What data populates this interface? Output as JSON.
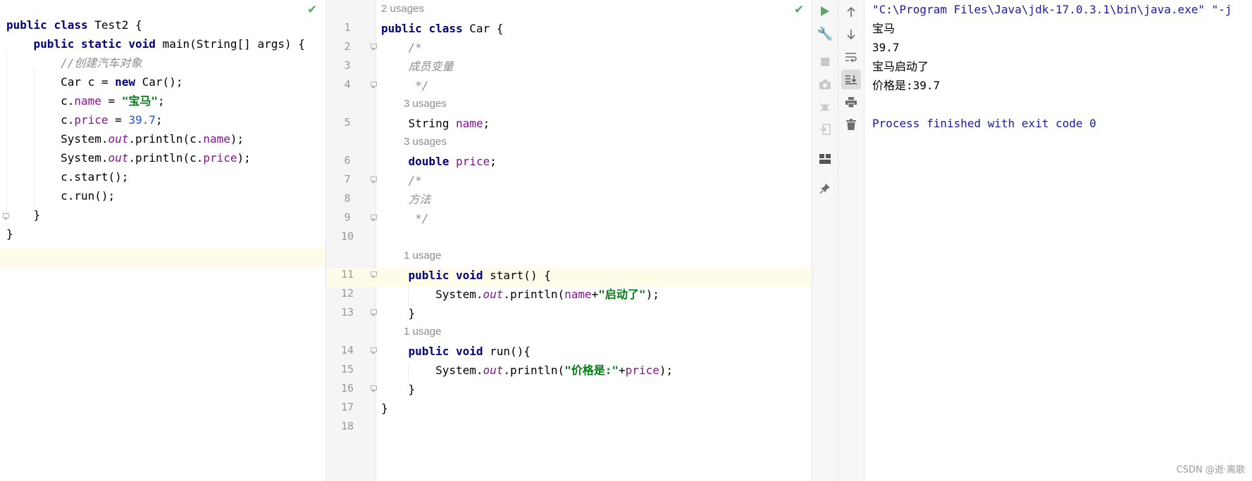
{
  "left_editor": {
    "lines": [
      {
        "parts": [
          [
            "kw2",
            "public "
          ],
          [
            "kw2",
            "class "
          ],
          [
            "",
            "Test2 {"
          ]
        ]
      },
      {
        "parts": [
          [
            "",
            "    "
          ],
          [
            "kw2",
            "public "
          ],
          [
            "kw2",
            "static "
          ],
          [
            "kw2",
            "void "
          ],
          [
            "",
            "main(String[] args) {"
          ]
        ]
      },
      {
        "parts": [
          [
            "",
            "        "
          ],
          [
            "cmt",
            "//创建汽车对象"
          ]
        ]
      },
      {
        "parts": [
          [
            "",
            "        Car c = "
          ],
          [
            "kw2",
            "new "
          ],
          [
            "",
            "Car();"
          ]
        ]
      },
      {
        "parts": [
          [
            "",
            "        c."
          ],
          [
            "fld",
            "name"
          ],
          [
            "",
            " = "
          ],
          [
            "str",
            "\"宝马\""
          ],
          [
            "",
            ";"
          ]
        ]
      },
      {
        "parts": [
          [
            "",
            "        c."
          ],
          [
            "fld",
            "price"
          ],
          [
            "",
            " = "
          ],
          [
            "num",
            "39.7"
          ],
          [
            "",
            ";"
          ]
        ]
      },
      {
        "parts": [
          [
            "",
            "        System."
          ],
          [
            "sta",
            "out"
          ],
          [
            "",
            ".println(c."
          ],
          [
            "fld",
            "name"
          ],
          [
            "",
            ");"
          ]
        ]
      },
      {
        "parts": [
          [
            "",
            "        System."
          ],
          [
            "sta",
            "out"
          ],
          [
            "",
            ".println(c."
          ],
          [
            "fld",
            "price"
          ],
          [
            "",
            ");"
          ]
        ]
      },
      {
        "parts": [
          [
            "",
            "        c.start();"
          ]
        ]
      },
      {
        "parts": [
          [
            "",
            "        c.run();"
          ]
        ]
      },
      {
        "parts": [
          [
            "",
            "    }"
          ]
        ]
      },
      {
        "parts": [
          [
            "",
            "}"
          ]
        ]
      }
    ]
  },
  "right_editor": {
    "top_hint": "2 usages",
    "rows": [
      {
        "num": "1",
        "hint": "",
        "parts": [
          [
            "kw2",
            "public "
          ],
          [
            "kw2",
            "class "
          ],
          [
            "",
            "Car {"
          ]
        ]
      },
      {
        "num": "2",
        "hint": "",
        "parts": [
          [
            "",
            "    "
          ],
          [
            "cmt",
            "/*"
          ]
        ]
      },
      {
        "num": "3",
        "hint": "",
        "parts": [
          [
            "",
            "    "
          ],
          [
            "cmt",
            "成员变量"
          ]
        ]
      },
      {
        "num": "4",
        "hint": "",
        "parts": [
          [
            "",
            "    "
          ],
          [
            "cmt",
            " */"
          ]
        ]
      },
      {
        "num": "",
        "hint": "3 usages",
        "parts": []
      },
      {
        "num": "5",
        "hint": "",
        "parts": [
          [
            "",
            "    String "
          ],
          [
            "fld",
            "name"
          ],
          [
            "",
            ";"
          ]
        ]
      },
      {
        "num": "",
        "hint": "3 usages",
        "parts": []
      },
      {
        "num": "6",
        "hint": "",
        "parts": [
          [
            "",
            "    "
          ],
          [
            "kw2",
            "double "
          ],
          [
            "fld",
            "price"
          ],
          [
            "",
            ";"
          ]
        ]
      },
      {
        "num": "7",
        "hint": "",
        "parts": [
          [
            "",
            "    "
          ],
          [
            "cmt",
            "/*"
          ]
        ]
      },
      {
        "num": "8",
        "hint": "",
        "parts": [
          [
            "",
            "    "
          ],
          [
            "cmt",
            "方法"
          ]
        ]
      },
      {
        "num": "9",
        "hint": "",
        "parts": [
          [
            "",
            "    "
          ],
          [
            "cmt",
            " */"
          ]
        ]
      },
      {
        "num": "10",
        "hint": "",
        "parts": []
      },
      {
        "num": "",
        "hint": "1 usage",
        "parts": []
      },
      {
        "num": "11",
        "hint": "",
        "parts": [
          [
            "",
            "    "
          ],
          [
            "kw2",
            "public "
          ],
          [
            "kw2",
            "void "
          ],
          [
            "",
            "start() {"
          ]
        ]
      },
      {
        "num": "12",
        "hint": "",
        "parts": [
          [
            "",
            "        System."
          ],
          [
            "sta",
            "out"
          ],
          [
            "",
            ".println("
          ],
          [
            "fld",
            "name"
          ],
          [
            "",
            "+"
          ],
          [
            "str",
            "\"启动了\""
          ],
          [
            "",
            ");"
          ]
        ]
      },
      {
        "num": "13",
        "hint": "",
        "parts": [
          [
            "",
            "    }"
          ]
        ]
      },
      {
        "num": "",
        "hint": "1 usage",
        "parts": []
      },
      {
        "num": "14",
        "hint": "",
        "parts": [
          [
            "",
            "    "
          ],
          [
            "kw2",
            "public "
          ],
          [
            "kw2",
            "void "
          ],
          [
            "",
            "run(){"
          ]
        ]
      },
      {
        "num": "15",
        "hint": "",
        "parts": [
          [
            "",
            "        System."
          ],
          [
            "sta",
            "out"
          ],
          [
            "",
            ".println("
          ],
          [
            "str",
            "\"价格是:\""
          ],
          [
            "",
            "+"
          ],
          [
            "fld",
            "price"
          ],
          [
            "",
            ");"
          ]
        ]
      },
      {
        "num": "16",
        "hint": "",
        "parts": [
          [
            "",
            "    }"
          ]
        ]
      },
      {
        "num": "17",
        "hint": "",
        "parts": [
          [
            "",
            "}"
          ]
        ]
      },
      {
        "num": "18",
        "hint": "",
        "parts": []
      }
    ]
  },
  "run_output": {
    "command": "\"C:\\Program Files\\Java\\jdk-17.0.3.1\\bin\\java.exe\" \"-j",
    "lines": [
      "宝马",
      "39.7",
      "宝马启动了",
      "价格是:39.7",
      ""
    ],
    "finish": "Process finished with exit code 0"
  },
  "watermark": "CSDN @逝·离歌",
  "colors": {
    "keyword": "#000080",
    "field": "#871094",
    "string": "#067d17",
    "number": "#1750eb",
    "comment": "#8c8c8c",
    "run_green": "#59a869",
    "output_blue": "#1a1aa6",
    "current_line": "#fefbe8"
  },
  "icons": {
    "status_ok": "check-icon",
    "run_toolbar": [
      "rerun-icon",
      "wrench-icon",
      "stop-icon",
      "camera-icon",
      "debug-icon",
      "exit-icon",
      "layout-icon",
      "pin-icon"
    ],
    "output_toolbar": [
      "arrow-up-icon",
      "arrow-down-icon",
      "soft-wrap-icon",
      "scroll-to-end-icon",
      "print-icon",
      "trash-icon"
    ]
  }
}
